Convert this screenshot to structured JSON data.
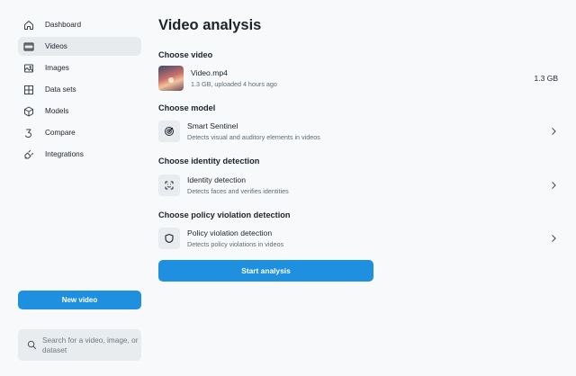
{
  "sidebar": {
    "items": [
      {
        "label": "Dashboard",
        "icon": "home-icon"
      },
      {
        "label": "Videos",
        "icon": "film-icon"
      },
      {
        "label": "Images",
        "icon": "image-icon"
      },
      {
        "label": "Data sets",
        "icon": "grid-icon"
      },
      {
        "label": "Models",
        "icon": "cube-icon"
      },
      {
        "label": "Compare",
        "icon": "compare-icon"
      },
      {
        "label": "Integrations",
        "icon": "plug-icon"
      }
    ],
    "active": "Videos",
    "new_video_label": "New video",
    "search_placeholder": "Search for a video, image, or dataset"
  },
  "main": {
    "title": "Video analysis",
    "video": {
      "section": "Choose video",
      "name": "Video.mp4",
      "meta": "1.3 GB, uploaded 4 hours ago",
      "size": "1.3 GB"
    },
    "model": {
      "section": "Choose model",
      "name": "Smart Sentinel",
      "desc": "Detects visual and auditory elements in videos",
      "icon": "target-icon"
    },
    "identity": {
      "section": "Choose identity detection",
      "name": "Identity detection",
      "desc": "Detects faces and verifies identities",
      "icon": "face-scan-icon"
    },
    "policy": {
      "section": "Choose policy violation detection",
      "name": "Policy violation detection",
      "desc": "Detects policy violations in videos",
      "icon": "shield-icon"
    },
    "start_label": "Start analysis"
  },
  "colors": {
    "accent": "#1e90df",
    "background": "#f7f9fa",
    "active_nav": "#e7ebee"
  }
}
